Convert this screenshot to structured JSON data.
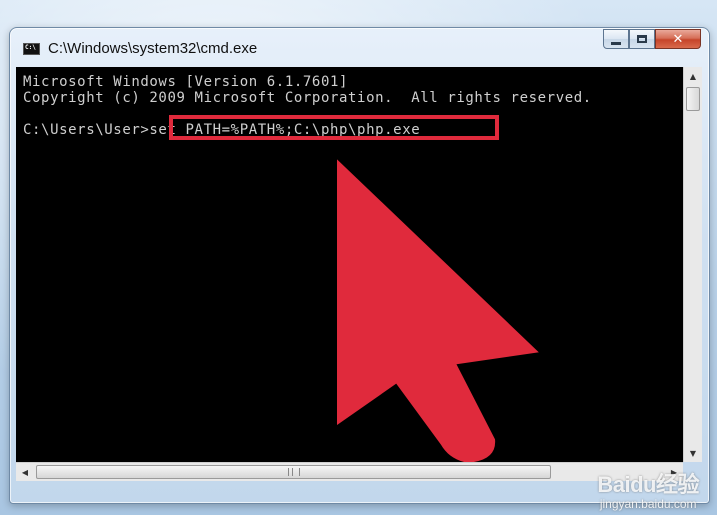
{
  "window": {
    "title": "C:\\Windows\\system32\\cmd.exe",
    "icon": "cmd-icon",
    "icon_text": "C:\\",
    "buttons": {
      "minimize": "minimize-icon",
      "maximize": "maximize-icon",
      "close": "close-icon",
      "close_glyph": "✕"
    }
  },
  "console": {
    "lines": [
      "Microsoft Windows [Version 6.1.7601]",
      "Copyright (c) 2009 Microsoft Corporation.  All rights reserved.",
      "",
      "C:\\Users\\User>set PATH=%PATH%;C:\\php\\php.exe"
    ],
    "highlight_color": "#e02a3c",
    "arrow_color": "#e02a3c",
    "text_color": "#cfcfcf",
    "background": "#000000"
  },
  "scrollbars": {
    "up_glyph": "▲",
    "down_glyph": "▼",
    "left_glyph": "◀",
    "right_glyph": "▶"
  },
  "watermark": {
    "logo": "Baidu经验",
    "url": "jingyan.baidu.com"
  }
}
